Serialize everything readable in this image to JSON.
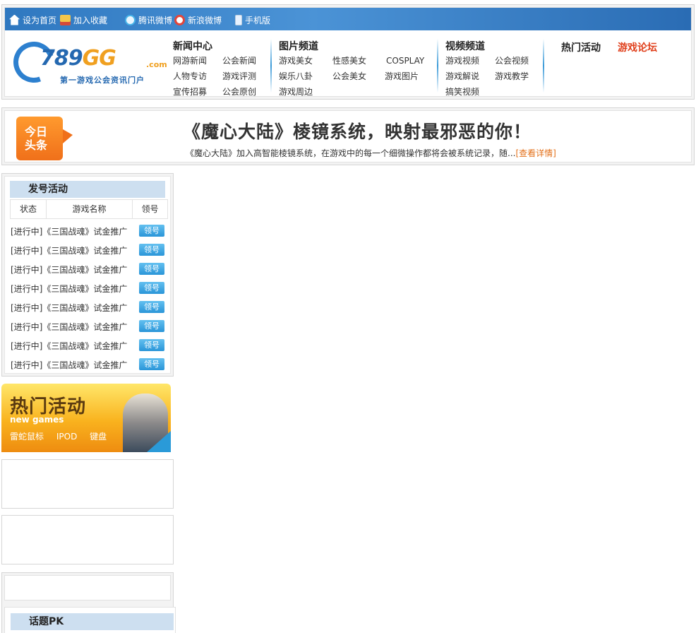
{
  "topbar": {
    "set_home": "设为首页",
    "add_fav": "加入收藏",
    "tencent_weibo": "腾讯微博",
    "sina_weibo": "新浪微博",
    "mobile": "手机版"
  },
  "logo": {
    "brand_789": "789",
    "brand_gg": "GG",
    "brand_com": ".com",
    "slogan": "第一游戏公会资讯门户"
  },
  "nav": {
    "news": {
      "title": "新闻中心",
      "links": [
        "网游新闻",
        "公会新闻",
        "人物专访",
        "游戏评测",
        "宣传招募",
        "公会原创"
      ]
    },
    "pics": {
      "title": "图片频道",
      "links": [
        "游戏美女",
        "性感美女",
        "COSPLAY",
        "娱乐八卦",
        "公会美女",
        "游戏图片",
        "游戏周边"
      ]
    },
    "video": {
      "title": "视频频道",
      "links": [
        "游戏视频",
        "公会视频",
        "游戏解说",
        "游戏教学",
        "搞笑视频"
      ]
    },
    "hot_events": "热门活动",
    "forum": "游戏论坛"
  },
  "colors": {
    "forum": "#e0401c",
    "accent": "#2f78c0",
    "more_link": "#e3701a"
  },
  "headline": {
    "badge_line1": "今日",
    "badge_line2": "头条",
    "title": "《魔心大陆》棱镜系统，映射最邪恶的你！",
    "desc": "《魔心大陆》加入高智能棱镜系统，在游戏中的每一个细微操作都将会被系统记录，随...",
    "more": "[查看详情]"
  },
  "gift": {
    "title": "发号活动",
    "columns": [
      "状态",
      "游戏名称",
      "领号"
    ],
    "rows": [
      {
        "status": "[进行中]",
        "name": "《三国战魂》试金推广",
        "btn": "领号"
      },
      {
        "status": "[进行中]",
        "name": "《三国战魂》试金推广",
        "btn": "领号"
      },
      {
        "status": "[进行中]",
        "name": "《三国战魂》试金推广",
        "btn": "领号"
      },
      {
        "status": "[进行中]",
        "name": "《三国战魂》试金推广",
        "btn": "领号"
      },
      {
        "status": "[进行中]",
        "name": "《三国战魂》试金推广",
        "btn": "领号"
      },
      {
        "status": "[进行中]",
        "name": "《三国战魂》试金推广",
        "btn": "领号"
      },
      {
        "status": "[进行中]",
        "name": "《三国战魂》试金推广",
        "btn": "领号"
      },
      {
        "status": "[进行中]",
        "name": "《三国战魂》试金推广",
        "btn": "领号"
      }
    ]
  },
  "hot_banner": {
    "title": "热门活动",
    "subtitle": "new games",
    "tags": [
      "雷蛇鼠标",
      "IPOD",
      "键盘"
    ]
  },
  "topic_pk": {
    "title": "话题PK"
  }
}
